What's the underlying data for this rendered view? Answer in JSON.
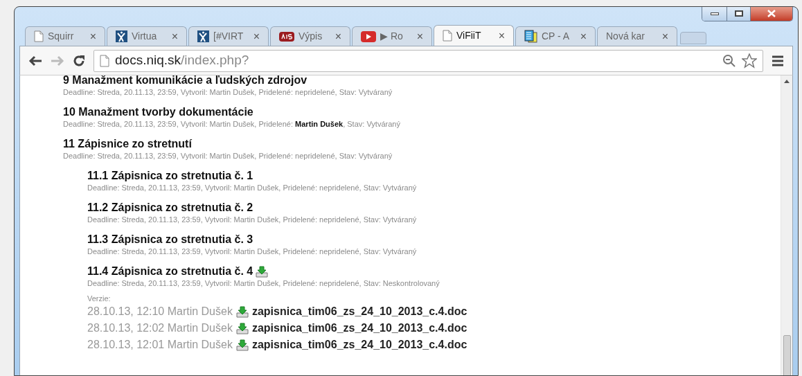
{
  "tabs": [
    {
      "label": "Squirr",
      "kind": "page",
      "selected": false
    },
    {
      "label": "Virtua",
      "kind": "people",
      "selected": false
    },
    {
      "label": "[#VIRT",
      "kind": "people",
      "selected": false
    },
    {
      "label": "Výpis",
      "kind": "ais",
      "selected": false
    },
    {
      "label": "▶ Ro",
      "kind": "video",
      "selected": false
    },
    {
      "label": "ViFiiT",
      "kind": "page",
      "selected": true
    },
    {
      "label": "CP - A",
      "kind": "doc",
      "selected": false
    },
    {
      "label": "Nová kar",
      "kind": "blank",
      "selected": false
    }
  ],
  "tab_close": "×",
  "address_bar": {
    "host": "docs.niq.sk",
    "path": "/index.php?"
  },
  "items": [
    {
      "title": "9 Manažment komunikácie a ľudských zdrojov",
      "meta": "Deadline: Streda, 20.11.13, 23:59, Vytvoril: Martin Dušek, Pridelené: nepridelené, Stav: Vytváraný",
      "has_file": false
    },
    {
      "title": "10 Manažment tvorby dokumentácie",
      "meta": "Deadline: Streda, 20.11.13, 23:59, Vytvoril: Martin Dušek, Pridelené: **Martin Dušek**, Stav: Vytváraný",
      "has_file": false
    },
    {
      "title": "11 Zápisnice zo stretnutí",
      "meta": "Deadline: Streda, 20.11.13, 23:59, Vytvoril: Martin Dušek, Pridelené: nepridelené, Stav: Vytváraný",
      "has_file": false,
      "children": [
        {
          "title": "11.1 Zápisnica zo stretnutia č. 1",
          "meta": "Deadline: Streda, 20.11.13, 23:59, Vytvoril: Martin Dušek, Pridelené: nepridelené, Stav: Vytváraný",
          "has_file": false
        },
        {
          "title": "11.2 Zápisnica zo stretnutia č. 2",
          "meta": "Deadline: Streda, 20.11.13, 23:59, Vytvoril: Martin Dušek, Pridelené: nepridelené, Stav: Vytváraný",
          "has_file": false
        },
        {
          "title": "11.3 Zápisnica zo stretnutia č. 3",
          "meta": "Deadline: Streda, 20.11.13, 23:59, Vytvoril: Martin Dušek, Pridelené: nepridelené, Stav: Vytváraný",
          "has_file": false
        },
        {
          "title": "11.4 Zápisnica zo stretnutia č. 4",
          "meta": "Deadline: Streda, 20.11.13, 23:59, Vytvoril: Martin Dušek, Pridelené: nepridelené, Stav: Neskontrolovaný",
          "has_file": true,
          "versions_label": "Verzie:",
          "versions": [
            {
              "stamp": "28.10.13, 12:10 Martin Dušek",
              "file": "zapisnica_tim06_zs_24_10_2013_c.4.doc"
            },
            {
              "stamp": "28.10.13, 12:02 Martin Dušek",
              "file": "zapisnica_tim06_zs_24_10_2013_c.4.doc"
            },
            {
              "stamp": "28.10.13, 12:01 Martin Dušek",
              "file": "zapisnica_tim06_zs_24_10_2013_c.4.doc"
            }
          ]
        }
      ]
    }
  ]
}
